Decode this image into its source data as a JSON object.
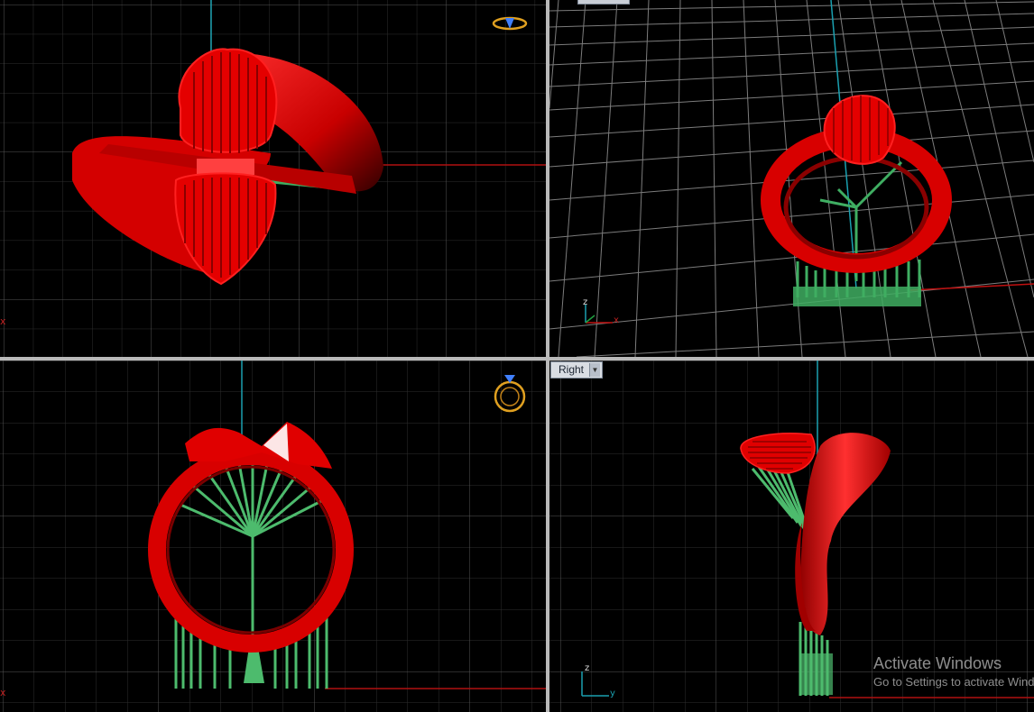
{
  "viewports": {
    "top_left": {
      "name": ""
    },
    "top_right": {
      "name": ""
    },
    "bottom_left": {
      "name": ""
    },
    "bottom_right": {
      "name": "Right"
    }
  },
  "axis_labels": {
    "x": "x",
    "y": "y",
    "z": "z"
  },
  "watermark": {
    "title": "Activate Windows",
    "subtitle": "Go to Settings to activate Windows."
  },
  "colors": {
    "model": "#e00000",
    "support": "#3fae62",
    "grid_minor": "#2e2e2e",
    "grid_major": "#5a5a5a",
    "axis_x": "#b01010",
    "axis_z": "#1aa0b0"
  },
  "icons": [
    "ring-gizmo-icon",
    "ring-gizmo-icon"
  ]
}
